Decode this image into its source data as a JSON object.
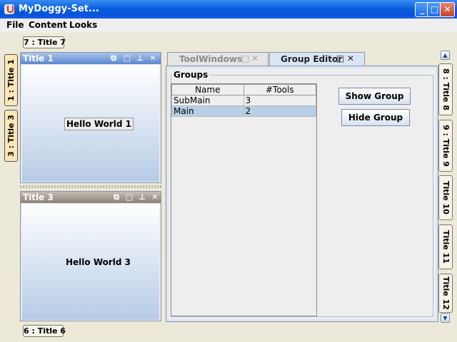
{
  "window": {
    "title": "MyDoggy-Set...",
    "min_icon": "minimize-icon",
    "max_icon": "maximize-icon",
    "close_icon": "close-icon"
  },
  "menu": [
    "File",
    "Content",
    "Looks"
  ],
  "top_anchors": [
    "7 : Title 7"
  ],
  "bottom_anchors": [
    "6 : Title 6"
  ],
  "left_anchors": [
    "1 : Title 1",
    "3 : Title 3"
  ],
  "right_anchors": [
    "8 : Title 8",
    "9 : Title 9",
    "Title 10",
    "Title 11",
    "Title 12"
  ],
  "toolwindow1": {
    "title": "Title 1",
    "content": "Hello World 1"
  },
  "toolwindow3": {
    "title": "Title 3",
    "content": "Hello World 3"
  },
  "tabs": [
    {
      "label": "ToolWindows",
      "active": false
    },
    {
      "label": "Group Editor",
      "active": true
    }
  ],
  "group_editor": {
    "section_title": "Groups",
    "columns": [
      "Name",
      "#Tools"
    ],
    "rows": [
      {
        "name": "SubMain",
        "tools": "3"
      },
      {
        "name": "Main",
        "tools": "2"
      }
    ],
    "selected_row": 1,
    "show_button": "Show Group",
    "hide_button": "Hide Group"
  },
  "colors": {
    "accent_title": "#0a5fe0",
    "active_toolbar": "#5c87cf",
    "inactive_toolbar": "#8c8178",
    "selection": "#b8cfe5"
  }
}
